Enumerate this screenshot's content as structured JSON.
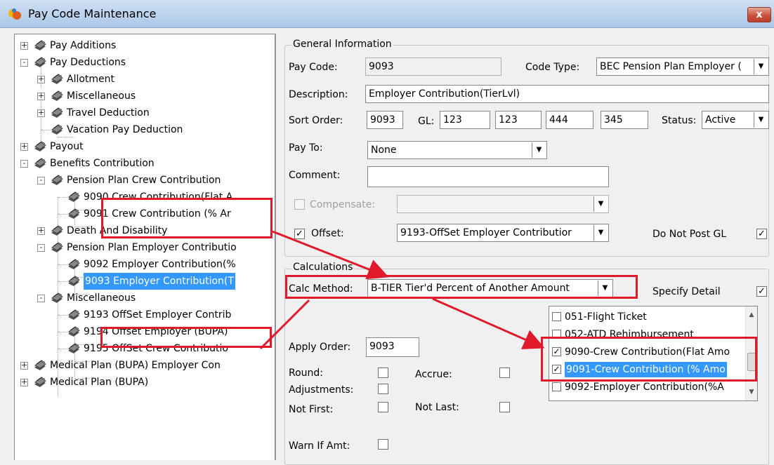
{
  "window": {
    "title": "Pay Code Maintenance",
    "close_glyph": "x"
  },
  "tree": {
    "items": [
      {
        "label": "Pay Additions",
        "expander": "+"
      },
      {
        "label": "Pay Deductions",
        "expander": "-"
      },
      {
        "label": "Allotment",
        "expander": "+"
      },
      {
        "label": "Miscellaneous",
        "expander": "+"
      },
      {
        "label": "Travel Deduction",
        "expander": "+"
      },
      {
        "label": "Vacation Pay Deduction",
        "expander": ""
      },
      {
        "label": "Payout",
        "expander": "+"
      },
      {
        "label": "Benefits Contribution",
        "expander": "-"
      },
      {
        "label": "Pension Plan Crew Contribution",
        "expander": "-"
      },
      {
        "label": "9090 Crew Contribution(Flat A",
        "expander": ""
      },
      {
        "label": "9091 Crew Contribution (% Ar",
        "expander": ""
      },
      {
        "label": "Death And Disability",
        "expander": "+"
      },
      {
        "label": "Pension Plan Employer Contributio",
        "expander": "-"
      },
      {
        "label": "9092 Employer Contribution(%",
        "expander": ""
      },
      {
        "label": "9093 Employer Contribution(T",
        "expander": "",
        "selected": true
      },
      {
        "label": "Miscellaneous",
        "expander": "-"
      },
      {
        "label": "9193 OffSet Employer Contrib",
        "expander": ""
      },
      {
        "label": "9194 Offset Employer (BUPA)",
        "expander": ""
      },
      {
        "label": "9195 OffSet Crew Contributio",
        "expander": ""
      },
      {
        "label": "Medical Plan (BUPA) Employer Con",
        "expander": "+"
      },
      {
        "label": "Medical Plan (BUPA)",
        "expander": "+"
      }
    ]
  },
  "general": {
    "legend": "General Information",
    "pay_code_label": "Pay Code:",
    "pay_code_value": "9093",
    "code_type_label": "Code Type:",
    "code_type_value": "BEC Pension Plan Employer (",
    "description_label": "Description:",
    "description_value": "Employer Contribution(TierLvl)",
    "sort_order_label": "Sort Order:",
    "sort_order_value": "9093",
    "gl_label": "GL:",
    "gl_values": [
      "123",
      "123",
      "444",
      "345"
    ],
    "status_label": "Status:",
    "status_value": "Active",
    "pay_to_label": "Pay To:",
    "pay_to_value": "None",
    "comment_label": "Comment:",
    "comment_value": "",
    "compensate_label": "Compensate:",
    "compensate_checked": false,
    "compensate_value": "",
    "offset_label": "Offset:",
    "offset_checked": true,
    "offset_value": "9193-OffSet Employer Contributior",
    "do_not_post_gl_label": "Do Not Post GL",
    "do_not_post_gl_checked": true
  },
  "calculations": {
    "legend": "Calculations",
    "calc_method_label": "Calc Method:",
    "calc_method_value": "B-TIER Tier'd Percent of Another Amount",
    "specify_detail_label": "Specify Detail",
    "specify_detail_checked": true,
    "apply_order_label": "Apply Order:",
    "apply_order_value": "9093",
    "round_label": "Round:",
    "accrue_label": "Accrue:",
    "adjustments_label": "Adjustments:",
    "not_first_label": "Not First:",
    "not_last_label": "Not Last:",
    "warn_if_amt_label": "Warn If Amt:",
    "detail_items": [
      {
        "label": "051-Flight Ticket",
        "checked": false,
        "selected": false
      },
      {
        "label": "052-ATD Rehimbursement",
        "checked": false,
        "selected": false
      },
      {
        "label": "9090-Crew Contribution(Flat Amo",
        "checked": true,
        "selected": false
      },
      {
        "label": "9091-Crew Contribution (% Amo",
        "checked": true,
        "selected": true
      },
      {
        "label": "9092-Employer Contribution(%A",
        "checked": false,
        "selected": false
      }
    ]
  },
  "glyphs": {
    "check": "✓",
    "dropdown": "▼",
    "scroll_up": "▲",
    "scroll_down": "▼"
  },
  "colors": {
    "highlight_red": "#e0192b",
    "selection_blue": "#3399ff"
  }
}
